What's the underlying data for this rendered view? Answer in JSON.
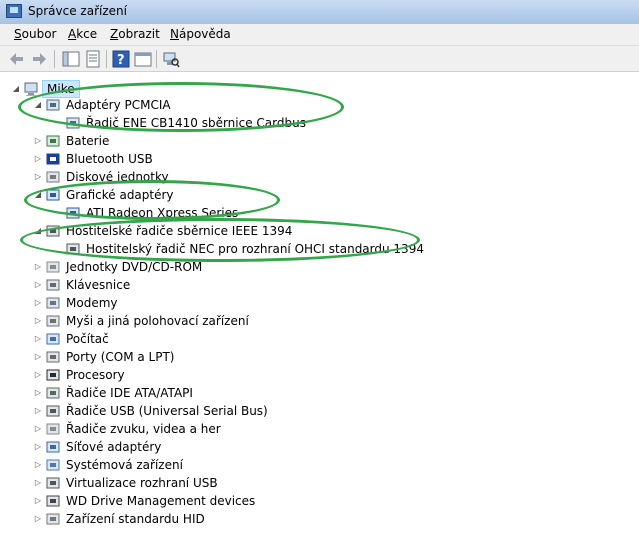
{
  "window": {
    "title": "Správce zařízení"
  },
  "menu": [
    {
      "u": "S",
      "rest": "oubor"
    },
    {
      "u": "A",
      "rest": "kce"
    },
    {
      "u": "Z",
      "rest": "obrazit"
    },
    {
      "u": "N",
      "rest": "ápověda"
    }
  ],
  "tree": {
    "root": "Mike",
    "items": [
      {
        "label": "Adaptéry PCMCIA",
        "icon": "pcmcia-icon",
        "expanded": true,
        "children": [
          {
            "label": "Řadič ENE CB1410 sběrnice Cardbus",
            "icon": "pcmcia-icon"
          }
        ]
      },
      {
        "label": "Baterie",
        "icon": "battery-icon"
      },
      {
        "label": "Bluetooth USB",
        "icon": "bluetooth-icon"
      },
      {
        "label": "Diskové jednotky",
        "icon": "disk-icon"
      },
      {
        "label": "Grafické adaptéry",
        "icon": "display-icon",
        "expanded": true,
        "children": [
          {
            "label": "ATI Radeon Xpress Series",
            "icon": "display-icon"
          }
        ]
      },
      {
        "label": "Hostitelské řadiče sběrnice IEEE 1394",
        "icon": "ieee1394-icon",
        "expanded": true,
        "children": [
          {
            "label": "Hostitelský řadič NEC pro rozhraní OHCI standardu 1394",
            "icon": "ieee1394-icon"
          }
        ]
      },
      {
        "label": "Jednotky DVD/CD-ROM",
        "icon": "dvd-icon"
      },
      {
        "label": "Klávesnice",
        "icon": "keyboard-icon"
      },
      {
        "label": "Modemy",
        "icon": "modem-icon"
      },
      {
        "label": "Myši a jiná polohovací zařízení",
        "icon": "mouse-icon"
      },
      {
        "label": "Počítač",
        "icon": "computer-icon"
      },
      {
        "label": "Porty (COM a LPT)",
        "icon": "port-icon"
      },
      {
        "label": "Procesory",
        "icon": "processor-icon"
      },
      {
        "label": "Řadiče IDE ATA/ATAPI",
        "icon": "ide-icon"
      },
      {
        "label": "Řadiče USB (Universal Serial Bus)",
        "icon": "usb-icon"
      },
      {
        "label": "Řadiče zvuku, videa a her",
        "icon": "sound-icon"
      },
      {
        "label": "Síťové adaptéry",
        "icon": "network-icon"
      },
      {
        "label": "Systémová zařízení",
        "icon": "system-icon"
      },
      {
        "label": "Virtualizace rozhraní USB",
        "icon": "usb-icon"
      },
      {
        "label": "WD Drive Management devices",
        "icon": "wd-icon"
      },
      {
        "label": "Zařízení standardu HID",
        "icon": "hid-icon"
      }
    ]
  },
  "colors": {
    "selection": "#cce8ff",
    "annotation": "#33a64a"
  }
}
